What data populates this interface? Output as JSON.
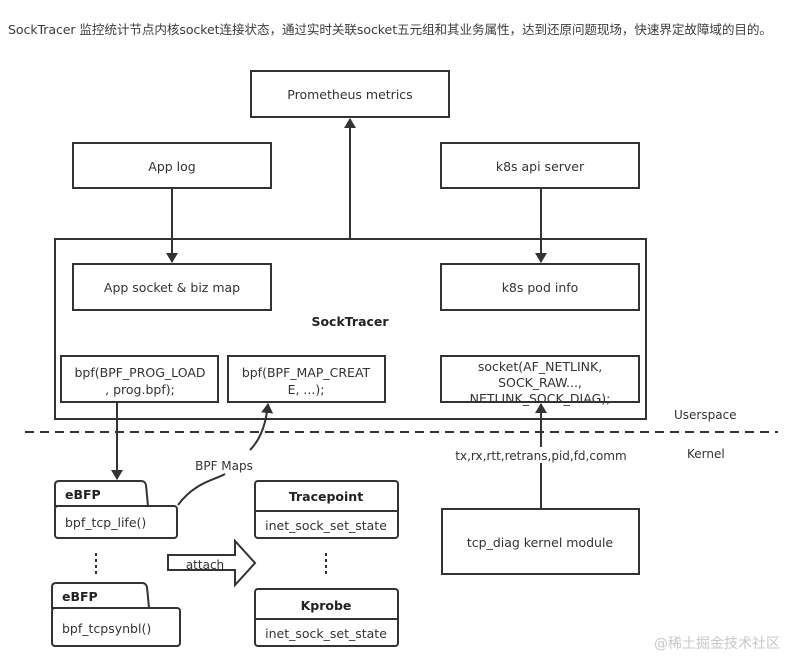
{
  "intro_text": "SockTracer 监控统计节点内核socket连接状态，通过实时关联socket五元组和其业务属性，达到还原问题现场，快速界定故障域的目的。",
  "diagram": {
    "prometheus": "Prometheus metrics",
    "app_log": "App log",
    "k8s_api_server": "k8s api server",
    "socktracer_label": "SockTracer",
    "app_socket_map": "App socket & biz map",
    "k8s_pod_info": "k8s pod info",
    "bpf_prog_load": [
      "bpf(BPF_PROG_LOAD",
      ", prog.bpf);"
    ],
    "bpf_map_create": [
      "bpf(BPF_MAP_CREAT",
      "E, ...);"
    ],
    "socket_netlink": [
      "socket(AF_NETLINK,",
      "SOCK_RAW...,",
      "NETLINK_SOCK_DIAG);"
    ],
    "userspace_label": "Userspace",
    "kernel_label": "Kernel",
    "bpf_maps_label": "BPF Maps",
    "diag_fields_label": "tx,rx,rtt,retrans,pid,fd,comm",
    "tcp_diag_module": "tcp_diag kernel module",
    "ebpf_programs": [
      {
        "title": "eBFP",
        "func": "bpf_tcp_life()"
      },
      {
        "title": "eBFP",
        "func": "bpf_tcpsynbl()"
      }
    ],
    "attach_label": "attach",
    "hooks": [
      {
        "title": "Tracepoint",
        "func": "inet_sock_set_state"
      },
      {
        "title": "Kprobe",
        "func": "inet_sock_set_state"
      }
    ],
    "ellipsis": "⋮"
  },
  "watermark": "@稀土掘金技术社区"
}
